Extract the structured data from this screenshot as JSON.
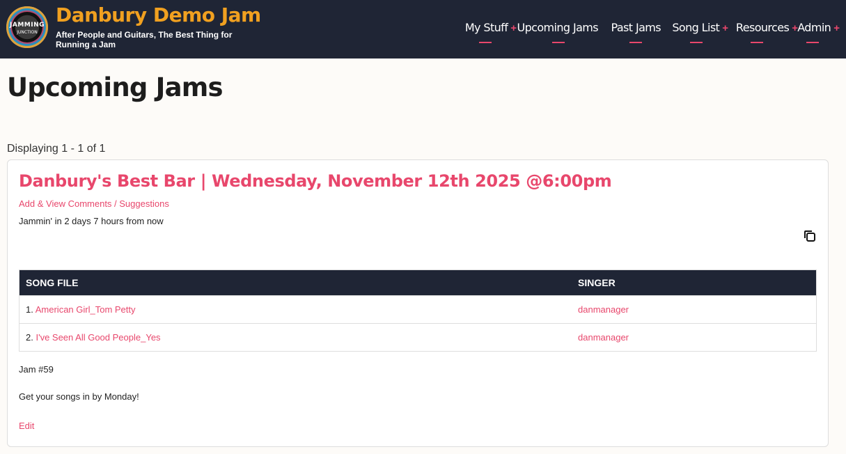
{
  "header": {
    "logo_text_top": "JAMMING",
    "logo_text_bottom": "JUNCTION",
    "site_title": "Danbury Demo Jam",
    "tagline": "After People and Guitars, The Best Thing for Running a Jam",
    "nav": [
      {
        "label": "My Stuff",
        "has_submenu": true,
        "plus": "+"
      },
      {
        "label": "Upcoming Jams",
        "has_submenu": false
      },
      {
        "label": "Past Jams",
        "has_submenu": false
      },
      {
        "label": "Song List",
        "has_submenu": true,
        "plus": "+"
      },
      {
        "label": "Resources",
        "has_submenu": true,
        "plus": "+"
      },
      {
        "label": "Admin",
        "has_submenu": true,
        "plus": "+"
      }
    ]
  },
  "main": {
    "page_title": "Upcoming Jams",
    "displaying": "Displaying 1 - 1 of 1",
    "jam": {
      "title": "Danbury's Best Bar | Wednesday, November 12th 2025 @6:00pm",
      "comments_link": "Add & View Comments / Suggestions",
      "countdown": "Jammin' in 2 days 7 hours from now",
      "copy_icon": "copy-icon",
      "table": {
        "headers": [
          "SONG FILE",
          "SINGER"
        ],
        "rows": [
          {
            "index": "1.",
            "song": "American Girl_Tom Petty",
            "singer": "danmanager"
          },
          {
            "index": "2.",
            "song": "I've Seen All Good People_Yes",
            "singer": "danmanager"
          }
        ]
      },
      "jam_number": "Jam #59",
      "note": "Get your songs in by Monday!",
      "edit_label": "Edit"
    }
  },
  "colors": {
    "header_bg": "#1f2535",
    "accent": "#e8476c",
    "title_gold": "#f0a020"
  }
}
